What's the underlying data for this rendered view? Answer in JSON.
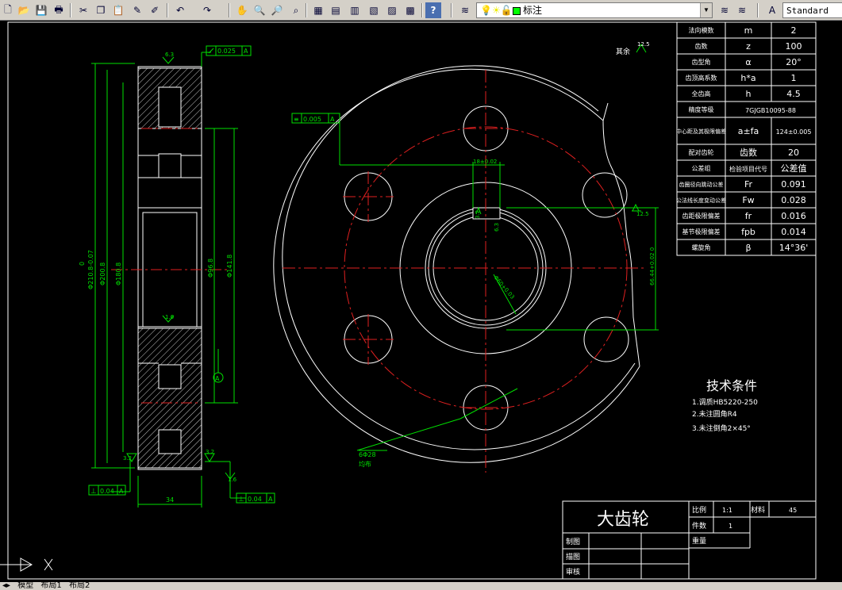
{
  "toolbar": {
    "layer_name": "标注",
    "style_name": "Standard",
    "icons": [
      "new-icon",
      "open-icon",
      "save-icon",
      "plot-icon",
      "preview-icon",
      "publish-icon",
      "cut-icon",
      "copy-icon",
      "paste-icon",
      "match-icon",
      "brush-icon",
      "undo-icon",
      "redo-icon",
      "pan-icon",
      "zoom-realtime-icon",
      "zoom-window-icon",
      "zoom-previous-icon",
      "properties-icon",
      "designcenter-icon",
      "toolpalette-icon",
      "sheetset-icon",
      "markup-icon",
      "calculator-icon",
      "help-icon"
    ]
  },
  "tabs": {
    "model": "模型",
    "layout1": "布局1",
    "layout2": "布局2"
  },
  "params": {
    "rows": [
      {
        "name": "法向模数",
        "sym": "m",
        "val": "2"
      },
      {
        "name": "齿数",
        "sym": "z",
        "val": "100"
      },
      {
        "name": "齿型角",
        "sym": "α",
        "val": "20°"
      },
      {
        "name": "齿顶高系数",
        "sym": "h*a",
        "val": "1"
      },
      {
        "name": "全齿高",
        "sym": "h",
        "val": "4.5"
      },
      {
        "name": "精度等级",
        "sym": "7GJGB10095-88",
        "val": ""
      },
      {
        "name": "中心距及其极限偏差",
        "sym": "a±fa",
        "val": "124±0.005"
      },
      {
        "name": "配对齿轮",
        "sym": "齿数",
        "val": "20"
      },
      {
        "name": "公差组",
        "sym": "检验项目代号",
        "val": "公差值"
      },
      {
        "name": "齿圈径向跳动公差",
        "sym": "Fr",
        "val": "0.091"
      },
      {
        "name": "公法线长度变动公差",
        "sym": "Fw",
        "val": "0.028"
      },
      {
        "name": "齿距极限偏差",
        "sym": "fr",
        "val": "0.016"
      },
      {
        "name": "基节极限偏差",
        "sym": "fpb",
        "val": "0.014"
      },
      {
        "name": "螺旋角",
        "sym": "β",
        "val": "14°36'"
      }
    ]
  },
  "title_block": {
    "title": "大齿轮",
    "scale_label": "比例",
    "scale_value": "1:1",
    "material_label": "材料",
    "material_value": "45",
    "count_label": "件数",
    "count_value": "1",
    "weight_label": "重量",
    "drawn_label": "制图",
    "traced_label": "描图",
    "checked_label": "审核"
  },
  "tech": {
    "title": "技术条件",
    "items": [
      "1.调质HB5220-250",
      "2.未注圆角R4",
      "3.未注倒角2×45°"
    ]
  },
  "dims": {
    "flatness": "0.025",
    "flatness_ref": "A",
    "symmetry": "0.005",
    "symmetry_ref": "A",
    "keyway_width": "18±0.02",
    "keyway_depth": "66.44+0.02 0",
    "bore_dia": "Φ60+0.03",
    "holes": "6Φ28",
    "holes_note": "均布",
    "other_rough": "其余",
    "rough_12_5": "12.5",
    "rough_3_2": "3.2",
    "rough_1_6": "1.6",
    "outer_dia": "Φ210.8-0.07",
    "outer_tol_top": "0",
    "dia_200": "Φ200.8",
    "dia_180": "Φ180.8",
    "dia_96": "Φ96.8",
    "dia_141": "Φ141.8",
    "width": "34",
    "perp1": "0.04",
    "perp1_ref": "A",
    "perp2": "0.04",
    "perp2_ref": "A",
    "datum": "A",
    "rough_6_3": "6.3"
  }
}
